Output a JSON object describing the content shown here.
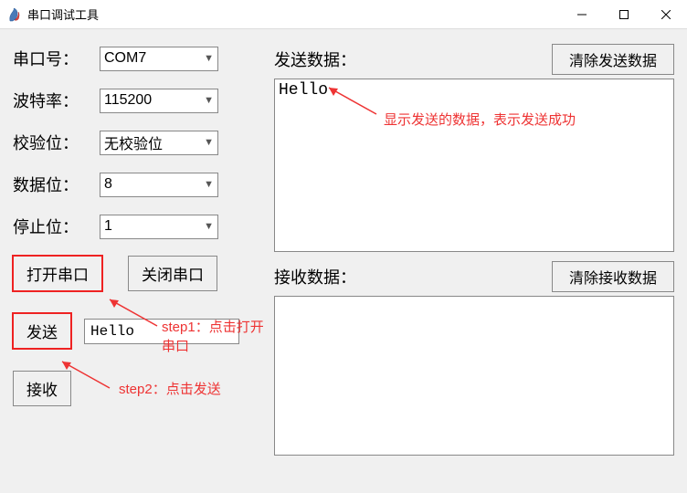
{
  "window": {
    "title": "串口调试工具"
  },
  "left": {
    "port_label": "串口号：",
    "port_value": "COM7",
    "baud_label": "波特率：",
    "baud_value": "115200",
    "parity_label": "校验位：",
    "parity_value": "无校验位",
    "databits_label": "数据位：",
    "databits_value": "8",
    "stopbits_label": "停止位：",
    "stopbits_value": "1",
    "open_btn": "打开串口",
    "close_btn": "关闭串口",
    "send_btn": "发送",
    "send_input": "Hello",
    "recv_btn": "接收"
  },
  "right": {
    "send_label": "发送数据：",
    "clear_send_btn": "清除发送数据",
    "send_content": "Hello",
    "recv_label": "接收数据：",
    "clear_recv_btn": "清除接收数据",
    "recv_content": ""
  },
  "annotations": {
    "step1": "step1：点击打开串口",
    "step2": "step2：点击发送",
    "send_tip": "显示发送的数据，表示发送成功"
  }
}
